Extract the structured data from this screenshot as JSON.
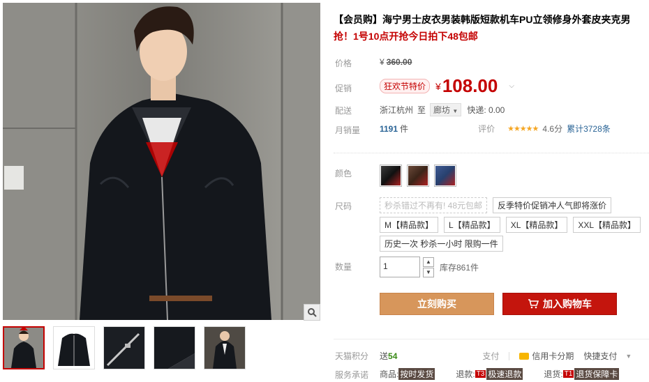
{
  "product": {
    "title": "【会员购】海宁男士皮衣男装韩版短款机车PU立领修身外套皮夹克男",
    "subtitle": "抢！1号10点开抢今日拍下48包邮"
  },
  "price": {
    "label": "价格",
    "currency": "¥",
    "original": "360.00"
  },
  "promo": {
    "label": "促销",
    "tag": "狂欢节特价",
    "currency": "¥",
    "price": "108.00"
  },
  "shipping": {
    "label": "配送",
    "from": "浙江杭州",
    "to_word": "至",
    "to_city": "廊坊",
    "express": "快递: 0.00"
  },
  "sales": {
    "label": "月销量",
    "count": "1191",
    "unit": "件",
    "review_label": "评价",
    "stars": "★★★★★",
    "score": "4.6分",
    "review_total": "累计3728条"
  },
  "color": {
    "label": "颜色",
    "swatches": [
      "#1a1a1a",
      "#3b2418",
      "#27406e"
    ]
  },
  "size": {
    "label": "尺码",
    "options": [
      "秒杀错过不再有! 48元包邮",
      "反季特价促销冲人气即将涨价",
      "M【精品款】",
      "L【精品款】",
      "XL【精品款】",
      "XXL【精品款】",
      "历史一次 秒杀一小时 限购一件"
    ]
  },
  "quantity": {
    "label": "数量",
    "value": "1",
    "stock": "库存861件"
  },
  "buttons": {
    "buy": "立刻购买",
    "cart": "加入购物车"
  },
  "points": {
    "label": "天猫积分",
    "value_prefix": "送",
    "value": "54",
    "pay_label": "支付",
    "credit": "信用卡分期",
    "quickpay": "快捷支付"
  },
  "service": {
    "label": "服务承诺",
    "goods": "商品:",
    "goods_tag": "按时发货",
    "refund": "退款:",
    "refund_code": "T3",
    "refund_tag": "极速退款",
    "return": "退货:",
    "return_code": "T1",
    "return_tag": "退货保障卡"
  },
  "icons": {
    "zoom": "magnifier-icon",
    "cart": "cart-icon",
    "chevron": "chevron-down-icon"
  }
}
